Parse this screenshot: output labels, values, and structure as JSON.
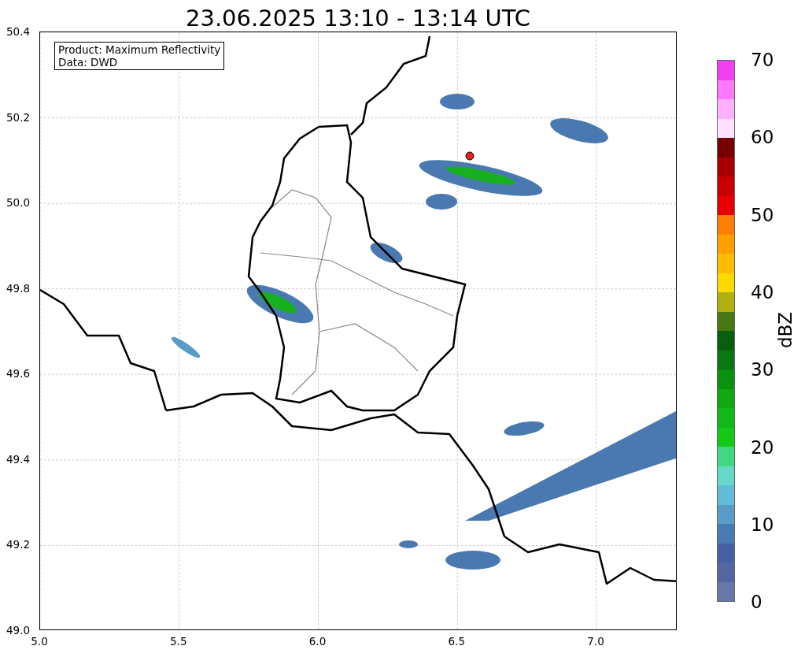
{
  "title": "23.06.2025 13:10 - 13:14 UTC",
  "map": {
    "info_box": [
      "Product: Maximum Reflectivity",
      "Data: DWD"
    ],
    "x_ticks": [
      "5.0",
      "5.5",
      "6.0",
      "6.5",
      "7.0"
    ],
    "y_ticks": [
      "50.4",
      "50.2",
      "50.0",
      "49.8",
      "49.6",
      "49.4",
      "49.2",
      "49.0"
    ]
  },
  "colorbar": {
    "label": "dBZ",
    "ticks": [
      "70",
      "60",
      "50",
      "40",
      "30",
      "20",
      "10",
      "0"
    ],
    "segments": [
      {
        "color": "#6677a8"
      },
      {
        "color": "#5565a0"
      },
      {
        "color": "#4660a4"
      },
      {
        "color": "#4a7ab2"
      },
      {
        "color": "#5a9cc8"
      },
      {
        "color": "#62bcd8"
      },
      {
        "color": "#66d8c8"
      },
      {
        "color": "#40d880"
      },
      {
        "color": "#16c818"
      },
      {
        "color": "#12b818"
      },
      {
        "color": "#10a810"
      },
      {
        "color": "#0c9010"
      },
      {
        "color": "#0a7812"
      },
      {
        "color": "#08600e"
      },
      {
        "color": "#4a7810"
      },
      {
        "color": "#b0b010"
      },
      {
        "color": "#ffd800"
      },
      {
        "color": "#ffbc00"
      },
      {
        "color": "#ffa000"
      },
      {
        "color": "#ff8000"
      },
      {
        "color": "#e80000"
      },
      {
        "color": "#c80000"
      },
      {
        "color": "#a80000"
      },
      {
        "color": "#780000"
      },
      {
        "color": "#ffe0ff"
      },
      {
        "color": "#ffb0ff"
      },
      {
        "color": "#ff78ff"
      },
      {
        "color": "#f040f0"
      }
    ]
  }
}
